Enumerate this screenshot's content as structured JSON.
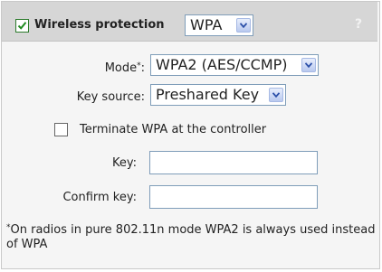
{
  "header": {
    "wireless_protection_checked": true,
    "wireless_protection_label": "Wireless protection",
    "protection_type_value": "WPA",
    "help_icon_text": "?"
  },
  "form": {
    "mode": {
      "label": "Mode",
      "required_marker": "*",
      "colon": ":",
      "value": "WPA2 (AES/CCMP)"
    },
    "key_source": {
      "label": "Key source:",
      "value": "Preshared Key"
    },
    "terminate": {
      "checked": false,
      "label": "Terminate WPA at the controller"
    },
    "key": {
      "label": "Key:",
      "value": ""
    },
    "confirm_key": {
      "label": "Confirm key:",
      "value": ""
    }
  },
  "footnote": {
    "marker": "*",
    "text": "On radios in pure 802.11n mode WPA2 is always used instead of WPA"
  },
  "colors": {
    "header_bg": "#d6d6d6",
    "panel_bg": "#f5f5f5",
    "input_border": "#7f9db9",
    "checkmark_green": "#1f8a1f"
  }
}
